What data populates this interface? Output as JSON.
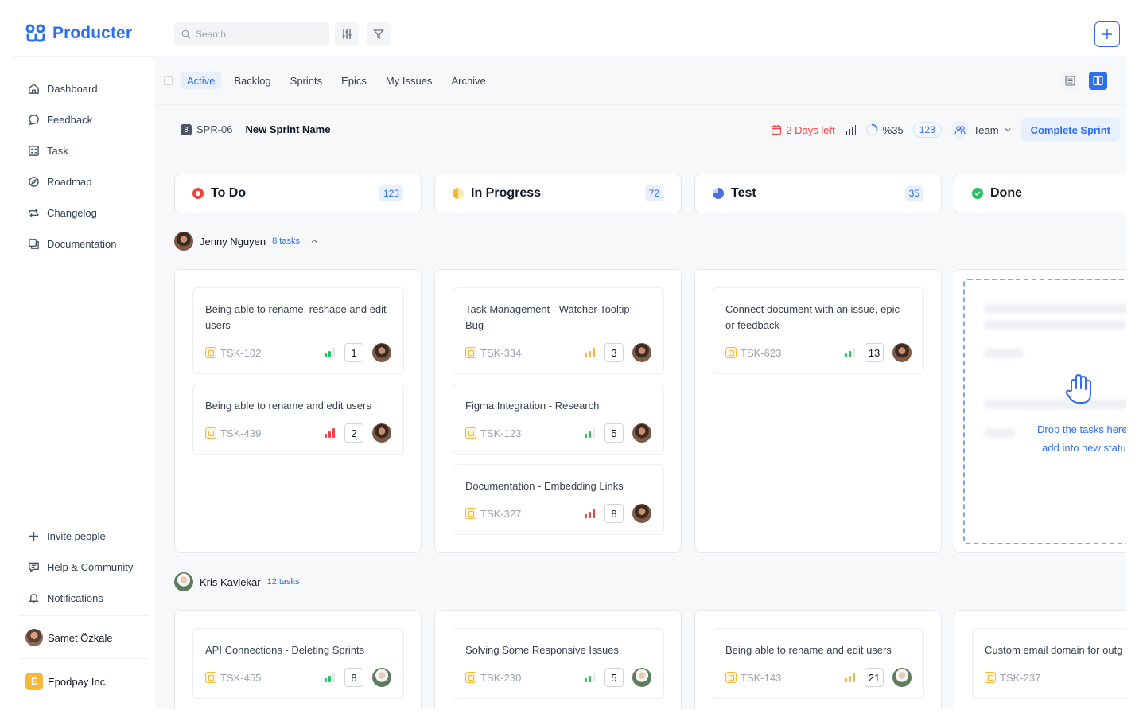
{
  "app": {
    "name": "Producter"
  },
  "sidebar": {
    "items": [
      {
        "label": "Dashboard",
        "icon": "home-icon"
      },
      {
        "label": "Feedback",
        "icon": "chat-bubble-icon"
      },
      {
        "label": "Task",
        "icon": "checklist-icon"
      },
      {
        "label": "Roadmap",
        "icon": "compass-icon"
      },
      {
        "label": "Changelog",
        "icon": "repeat-icon"
      },
      {
        "label": "Documentation",
        "icon": "documents-icon"
      }
    ],
    "bottom_items": [
      {
        "label": "Invite people",
        "icon": "plus-icon"
      },
      {
        "label": "Help & Community",
        "icon": "help-chat-icon"
      },
      {
        "label": "Notifications",
        "icon": "bell-icon"
      }
    ],
    "user": {
      "name": "Samet Özkale"
    },
    "org": {
      "name": "Epodpay Inc.",
      "initial": "E"
    }
  },
  "search": {
    "placeholder": "Search"
  },
  "tabs": [
    "Active",
    "Backlog",
    "Sprints",
    "Epics",
    "My Issues",
    "Archive"
  ],
  "active_tab": "Active",
  "sprint": {
    "icon_text": "8",
    "id": "SPR-06",
    "name": "New Sprint Name",
    "days_left": "2 Days left",
    "progress": "%35",
    "count": "123",
    "team": "Team",
    "complete_label": "Complete Sprint"
  },
  "columns": [
    {
      "title": "To Do",
      "count": "123",
      "color": "#ef4444"
    },
    {
      "title": "In Progress",
      "count": "72",
      "color": "#f5b937"
    },
    {
      "title": "Test",
      "count": "35",
      "color": "#4f6fe0"
    },
    {
      "title": "Done",
      "count": "",
      "color": "#22c55e"
    }
  ],
  "groups": [
    {
      "name": "Jenny Nguyen",
      "count_label": "8 tasks",
      "lanes": [
        [
          {
            "title": "Being able to rename, reshape and edit users",
            "id": "TSK-102",
            "priority": "low",
            "num": "1"
          },
          {
            "title": "Being able to rename and edit users",
            "id": "TSK-439",
            "priority": "high",
            "num": "2"
          }
        ],
        [
          {
            "title": "Task Management - Watcher Tooltip Bug",
            "id": "TSK-334",
            "priority": "medium",
            "num": "3"
          },
          {
            "title": "Figma Integration - Research",
            "id": "TSK-123",
            "priority": "low",
            "num": "5"
          },
          {
            "title": "Documentation - Embedding Links",
            "id": "TSK-327",
            "priority": "high",
            "num": "8"
          }
        ],
        [
          {
            "title": "Connect document with an issue, epic or feedback",
            "id": "TSK-623",
            "priority": "low",
            "num": "13"
          }
        ]
      ]
    },
    {
      "name": "Kris Kavlekar",
      "count_label": "12 tasks",
      "lanes": [
        [
          {
            "title": "API Connections - Deleting Sprints",
            "id": "TSK-455",
            "priority": "low",
            "num": "8"
          }
        ],
        [
          {
            "title": "Solving Some Responsive Issues",
            "id": "TSK-230",
            "priority": "low",
            "num": "5"
          }
        ],
        [
          {
            "title": "Being able to rename and edit users",
            "id": "TSK-143",
            "priority": "medium",
            "num": "21"
          }
        ],
        [
          {
            "title": "Custom email domain for outg",
            "id": "TSK-237",
            "priority": "high",
            "num": ""
          }
        ]
      ]
    }
  ],
  "dropzone": {
    "line1": "Drop the tasks here to",
    "line2": "add into new status."
  },
  "colors": {
    "accent": "#2f6fed",
    "low": "#22c55e",
    "medium": "#f5b937",
    "high": "#ef4444"
  }
}
